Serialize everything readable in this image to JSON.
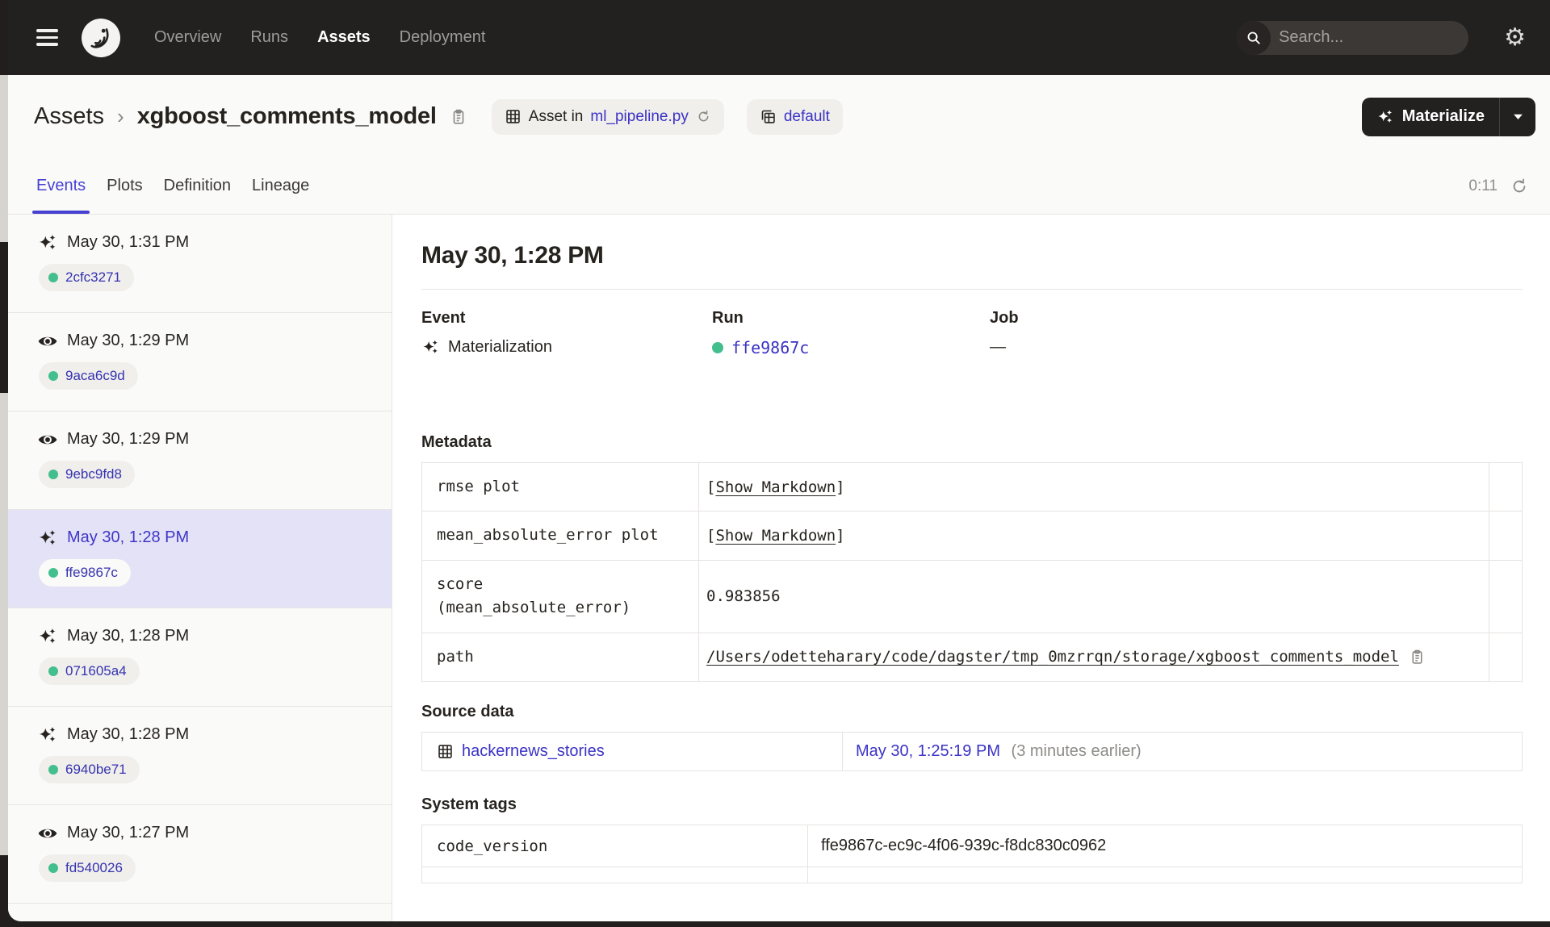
{
  "topnav": {
    "nav_items": [
      {
        "label": "Overview",
        "active": false
      },
      {
        "label": "Runs",
        "active": false
      },
      {
        "label": "Assets",
        "active": true
      },
      {
        "label": "Deployment",
        "active": false
      }
    ],
    "search": {
      "placeholder": "Search...",
      "shortcut": "/"
    }
  },
  "breadcrumb": {
    "root": "Assets",
    "separator": "›",
    "asset_name": "xgboost_comments_model"
  },
  "asset_badges": {
    "asset_in_prefix": "Asset in",
    "asset_in_link": "ml_pipeline.py",
    "group_label": "default"
  },
  "materialize": {
    "label": "Materialize"
  },
  "tabs": {
    "items": [
      {
        "label": "Events",
        "active": true
      },
      {
        "label": "Plots",
        "active": false
      },
      {
        "label": "Definition",
        "active": false
      },
      {
        "label": "Lineage",
        "active": false
      }
    ],
    "refresh_timer": "0:11"
  },
  "sidebar": {
    "events": [
      {
        "icon": "materialization",
        "time": "May 30, 1:31 PM",
        "run_id": "2cfc3271",
        "selected": false
      },
      {
        "icon": "observation",
        "time": "May 30, 1:29 PM",
        "run_id": "9aca6c9d",
        "selected": false
      },
      {
        "icon": "observation",
        "time": "May 30, 1:29 PM",
        "run_id": "9ebc9fd8",
        "selected": false
      },
      {
        "icon": "materialization",
        "time": "May 30, 1:28 PM",
        "run_id": "ffe9867c",
        "selected": true
      },
      {
        "icon": "materialization",
        "time": "May 30, 1:28 PM",
        "run_id": "071605a4",
        "selected": false
      },
      {
        "icon": "materialization",
        "time": "May 30, 1:28 PM",
        "run_id": "6940be71",
        "selected": false
      },
      {
        "icon": "observation",
        "time": "May 30, 1:27 PM",
        "run_id": "fd540026",
        "selected": false
      }
    ]
  },
  "detail": {
    "title": "May 30, 1:28 PM",
    "summary": {
      "event_label": "Event",
      "event_value": "Materialization",
      "run_label": "Run",
      "run_value": "ffe9867c",
      "job_label": "Job",
      "job_value": "—"
    },
    "metadata": {
      "heading": "Metadata",
      "bracket_open": "[",
      "bracket_close": "]",
      "rows": [
        {
          "key": "rmse plot",
          "type": "markdown",
          "value": "Show Markdown"
        },
        {
          "key": "mean_absolute_error plot",
          "type": "markdown",
          "value": "Show Markdown"
        },
        {
          "key": "score\n(mean_absolute_error)",
          "type": "text",
          "value": "0.983856"
        },
        {
          "key": "path",
          "type": "path",
          "value": "/Users/odetteharary/code/dagster/tmp_0mzrrqn/storage/xgboost_comments_model"
        }
      ]
    },
    "source_data": {
      "heading": "Source data",
      "asset_link": "hackernews_stories",
      "time_link": "May 30, 1:25:19 PM",
      "relative": "(3 minutes earlier)"
    },
    "system_tags": {
      "heading": "System tags",
      "rows": [
        {
          "key": "code_version",
          "value": "ffe9867c-ec9c-4f06-939c-f8dc830c0962"
        }
      ]
    }
  },
  "colors": {
    "nav_bg": "#232020",
    "page_bg": "#FAFAF9",
    "accent_indigo": "#4741D3",
    "link_indigo": "#3B33C4",
    "run_green": "#43BE8D",
    "selected_bg": "#E4E2F6",
    "border": "#E6E4E1"
  },
  "icons": [
    "hamburger-icon",
    "dagster-logo",
    "search-icon",
    "slash-shortcut-badge",
    "gear-icon",
    "copy-icon",
    "asset-grid-icon",
    "asset-group-icon",
    "reload-icon",
    "caret-down-icon",
    "materialization-sparkle-icon",
    "observation-eye-icon",
    "refresh-icon"
  ]
}
